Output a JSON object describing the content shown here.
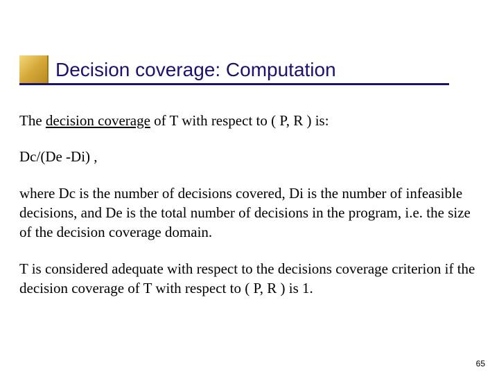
{
  "title": "Decision coverage: Computation",
  "p1_pre": "The ",
  "p1_u": "decision coverage",
  "p1_post": " of  T  with respect to ( P, R ) is:",
  "p2": "Dc/(De -Di) ,",
  "p3": "where  Dc  is the number of decisions covered,  Di  is the number of infeasible decisions, and  De  is the total number of decisions in the program, i.e. the size of the decision coverage domain.",
  "p4": "T  is considered adequate  with respect to the decisions coverage criterion if  the decision  coverage of  T  with respect to ( P, R ) is 1.",
  "page_number": "65"
}
